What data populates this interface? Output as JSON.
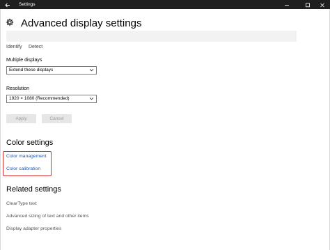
{
  "window": {
    "title": "Settings"
  },
  "header": {
    "title": "Advanced display settings"
  },
  "monitor_links": {
    "identify": "Identify",
    "detect": "Detect"
  },
  "multiple_displays": {
    "label": "Multiple displays",
    "value": "Extend these displays"
  },
  "resolution": {
    "label": "Resolution",
    "value": "1920 × 1080 (Recommended)"
  },
  "buttons": {
    "apply": "Apply",
    "cancel": "Cancel"
  },
  "color_settings": {
    "heading": "Color settings",
    "links": [
      "Color management",
      "Color calibration"
    ]
  },
  "related_settings": {
    "heading": "Related settings",
    "links": [
      "ClearType text",
      "Advanced sizing of text and other items",
      "Display adapter properties"
    ]
  },
  "colors": {
    "accent_link": "#1a5bb5",
    "highlight_box": "#d32f2f",
    "titlebar": "#1f1f1f"
  }
}
